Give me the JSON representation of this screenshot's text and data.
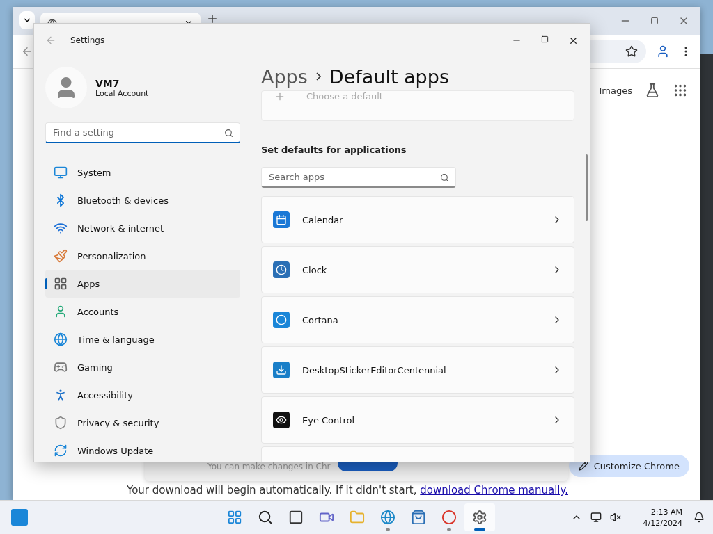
{
  "chrome": {
    "tab": {
      "selected": true
    },
    "links": [
      "Images"
    ],
    "notice": "You can make changes in Chr",
    "download": {
      "text": "Your download will begin automatically. If it didn't start, ",
      "link": "download Chrome manually."
    },
    "customize_button": "Customize Chrome"
  },
  "settings": {
    "title": "Settings",
    "user": {
      "name": "VM7",
      "account": "Local Account"
    },
    "search": {
      "placeholder": "Find a setting",
      "focused": true
    },
    "nav": [
      {
        "label": "System",
        "kind": "system",
        "selected": false
      },
      {
        "label": "Bluetooth & devices",
        "kind": "bluetooth",
        "selected": false
      },
      {
        "label": "Network & internet",
        "kind": "network",
        "selected": false
      },
      {
        "label": "Personalization",
        "kind": "brush",
        "selected": false
      },
      {
        "label": "Apps",
        "kind": "apps",
        "selected": true
      },
      {
        "label": "Accounts",
        "kind": "accounts",
        "selected": false
      },
      {
        "label": "Time & language",
        "kind": "time",
        "selected": false
      },
      {
        "label": "Gaming",
        "kind": "gaming",
        "selected": false
      },
      {
        "label": "Accessibility",
        "kind": "accessibility",
        "selected": false
      },
      {
        "label": "Privacy & security",
        "kind": "privacy",
        "selected": false
      },
      {
        "label": "Windows Update",
        "kind": "update",
        "selected": false
      }
    ],
    "breadcrumb": {
      "parent": "Apps",
      "current": "Default apps"
    },
    "choose_default": "Choose a default",
    "section": "Set defaults for applications",
    "app_search": {
      "placeholder": "Search apps"
    },
    "apps": [
      {
        "name": "Calendar",
        "kind": "calendar"
      },
      {
        "name": "Clock",
        "kind": "clock"
      },
      {
        "name": "Cortana",
        "kind": "cortana"
      },
      {
        "name": "DesktopStickerEditorCentennial",
        "kind": "sticker"
      },
      {
        "name": "Eye Control",
        "kind": "eye"
      }
    ]
  },
  "taskbar": {
    "apps": [
      {
        "kind": "start",
        "running": false,
        "selected": false
      },
      {
        "kind": "search",
        "running": false,
        "selected": false
      },
      {
        "kind": "taskview",
        "running": false,
        "selected": false
      },
      {
        "kind": "chat",
        "running": false,
        "selected": false
      },
      {
        "kind": "files",
        "running": false,
        "selected": false
      },
      {
        "kind": "edge",
        "running": true,
        "selected": false
      },
      {
        "kind": "store",
        "running": false,
        "selected": false
      },
      {
        "kind": "chrome",
        "running": true,
        "selected": false
      },
      {
        "kind": "settings",
        "running": true,
        "selected": true
      }
    ],
    "time": "2:13 AM",
    "date": "4/12/2024"
  }
}
